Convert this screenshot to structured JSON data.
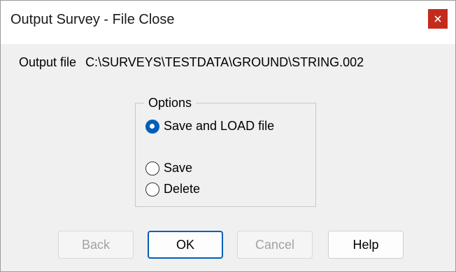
{
  "window": {
    "title": "Output Survey - File Close",
    "close_icon": "close-icon",
    "close_color": "#c42b1c"
  },
  "output": {
    "label": "Output file",
    "path": "C:\\SURVEYS\\TESTDATA\\GROUND\\STRING.002"
  },
  "options": {
    "legend": "Options",
    "items": [
      {
        "label": "Save and LOAD file",
        "selected": true
      },
      {
        "label": "Save",
        "selected": false
      },
      {
        "label": "Delete",
        "selected": false
      }
    ]
  },
  "buttons": {
    "back": "Back",
    "ok": "OK",
    "cancel": "Cancel",
    "help": "Help"
  },
  "colors": {
    "accent": "#005fb8",
    "disabled_text": "#a3a3a3"
  }
}
